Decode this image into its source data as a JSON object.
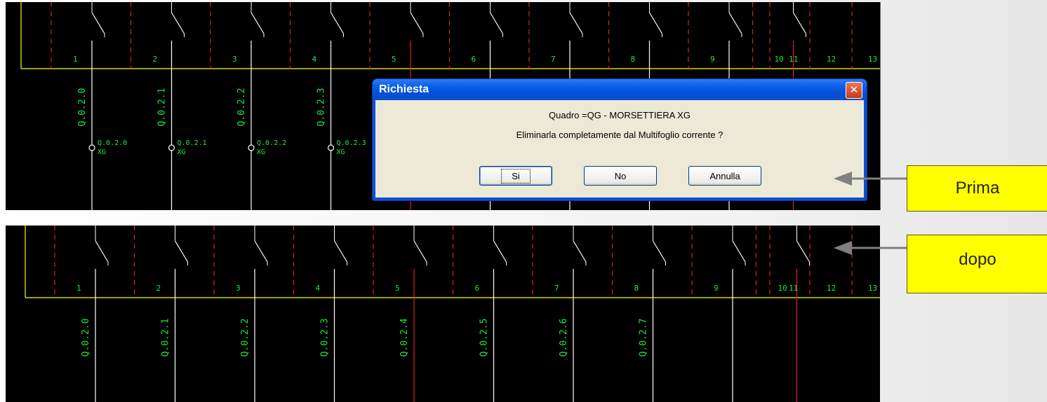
{
  "before_panel": {
    "column_numbers": [
      "1",
      "2",
      "3",
      "4",
      "5",
      "6",
      "7",
      "8",
      "9",
      "10",
      "11",
      "12",
      "13"
    ],
    "addresses": [
      "Q.0.2.0",
      "Q.0.2.1",
      "Q.0.2.2",
      "Q.0.2.3"
    ],
    "terminals": [
      {
        "address": "Q.0.2.0",
        "board": "XG"
      },
      {
        "address": "Q.0.2.1",
        "board": "XG"
      },
      {
        "address": "Q.0.2.2",
        "board": "XG"
      },
      {
        "address": "Q.0.2.3",
        "board": "XG"
      }
    ]
  },
  "after_panel": {
    "column_numbers": [
      "1",
      "2",
      "3",
      "4",
      "5",
      "6",
      "7",
      "8",
      "9",
      "10",
      "11",
      "12",
      "13"
    ],
    "addresses": [
      "Q.0.2.0",
      "Q.0.2.1",
      "Q.0.2.2",
      "Q.0.2.3",
      "Q.0.2.4",
      "Q.0.2.5",
      "Q.0.2.6",
      "Q.0.2.7"
    ]
  },
  "dialog": {
    "title": "Richiesta",
    "close_symbol": "✕",
    "line1": "Quadro =QG - MORSETTIERA XG",
    "line2": "Eliminarla completamente dal Multifoglio corrente ?",
    "buttons": {
      "yes": "Si",
      "no": "No",
      "cancel": "Annulla"
    }
  },
  "labels": {
    "before": "Prima",
    "after": "dopo"
  },
  "colors": {
    "background": "#000000",
    "cad_text": "#1ee83c",
    "frame_line": "#ffff00",
    "dashed_line": "#e02020",
    "wire": "#ffffff",
    "label_fill": "#ffff00",
    "arrow": "#808080"
  },
  "icons": {
    "close": "close-icon",
    "arrow": "arrow-left-icon"
  }
}
